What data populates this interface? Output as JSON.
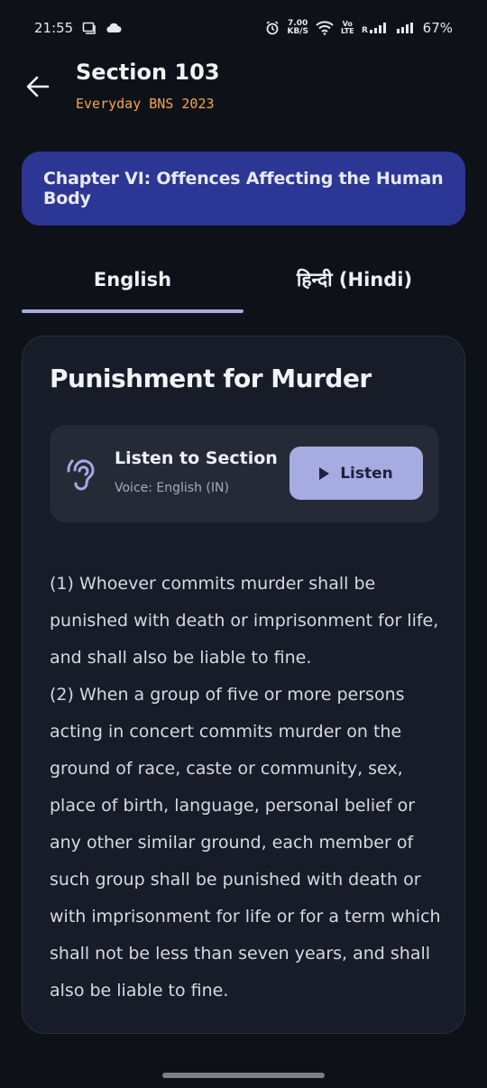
{
  "status_bar": {
    "time": "21:55",
    "net_speed_value": "7.00",
    "net_speed_unit": "KB/S",
    "volte_top": "Vo",
    "volte_bottom": "LTE",
    "battery": "67%"
  },
  "app_bar": {
    "title": "Section 103",
    "subtitle": "Everyday BNS 2023",
    "back_icon": "arrow-left-icon"
  },
  "chapter": {
    "text": "Chapter VI: Offences Affecting the Human Body"
  },
  "tabs": [
    {
      "label": "English",
      "selected": true
    },
    {
      "label": "हिन्दी (Hindi)",
      "selected": false
    }
  ],
  "section": {
    "title": "Punishment for Murder",
    "listen": {
      "title": "Listen to Section",
      "voice": "Voice: English (IN)",
      "button_label": "Listen",
      "icon": "hearing-icon"
    },
    "paragraphs": [
      "(1) Whoever commits murder shall be punished with death or imprisonment for life, and shall also be liable to fine.",
      "(2) When a group of five or more persons acting in concert commits murder on the ground of race, caste or community, sex, place of birth, language, personal belief or any other similar ground, each member of such group shall be punished with death or with imprisonment for life or for a term which shall not be less than seven years, and shall also be liable to fine."
    ]
  },
  "colors": {
    "background": "#0e1117",
    "chapter_banner": "#2c3694",
    "accent": "#a6ace2",
    "subtitle": "#f3a64a",
    "card": "#181c28"
  }
}
